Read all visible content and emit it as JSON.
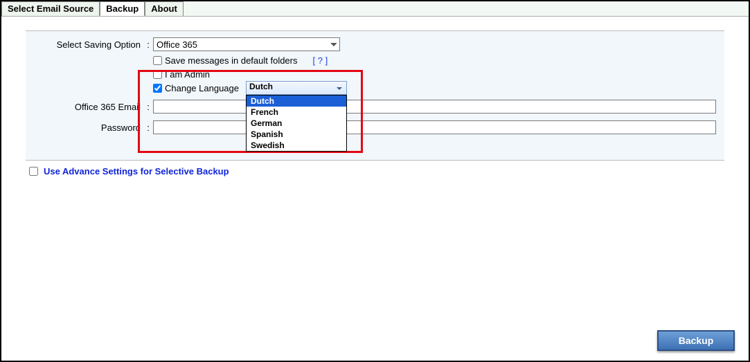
{
  "tabs": {
    "source": "Select Email Source",
    "backup": "Backup",
    "about": "About"
  },
  "form": {
    "saving_option_label": "Select Saving Option",
    "saving_option_value": "Office 365",
    "save_default_label": "Save messages in default folders",
    "help_text": "[ ? ]",
    "admin_label": "I am Admin",
    "change_lang_label": "Change Language",
    "lang_selected": "Dutch",
    "lang_options": [
      "Dutch",
      "French",
      "German",
      "Spanish",
      "Swedish"
    ],
    "email_label": "Office 365 Email",
    "email_value": "",
    "password_label": "Password",
    "password_value": ""
  },
  "advanced": {
    "label": "Use Advance Settings for Selective Backup"
  },
  "backup_button": "Backup",
  "colors": {
    "highlight": "#e30613",
    "link": "#1024d8",
    "button_bg": "#3d71b5"
  }
}
